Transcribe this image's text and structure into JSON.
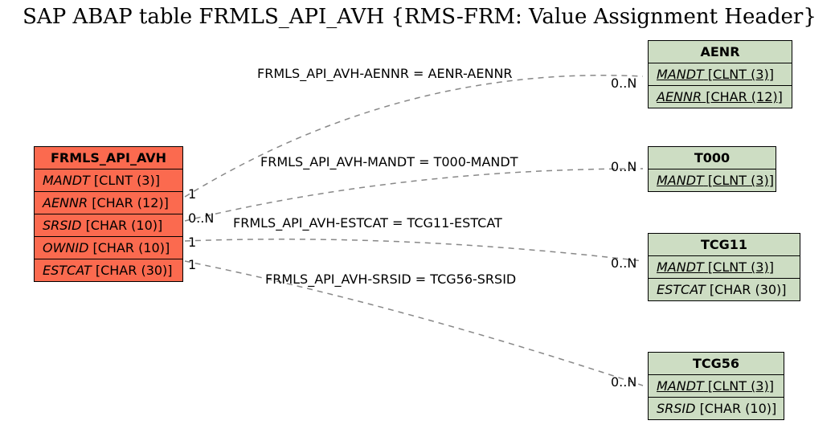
{
  "title": "SAP ABAP table FRMLS_API_AVH {RMS-FRM: Value Assignment Header}",
  "main": {
    "name": "FRMLS_API_AVH",
    "fields": [
      {
        "f": "MANDT",
        "t": "[CLNT (3)]"
      },
      {
        "f": "AENNR",
        "t": "[CHAR (12)]"
      },
      {
        "f": "SRSID",
        "t": "[CHAR (10)]"
      },
      {
        "f": "OWNID",
        "t": "[CHAR (10)]"
      },
      {
        "f": "ESTCAT",
        "t": "[CHAR (30)]"
      }
    ]
  },
  "rel": {
    "r1": {
      "label": "FRMLS_API_AVH-AENNR = AENR-AENNR",
      "left": "1",
      "right": "0..N"
    },
    "r2": {
      "label": "FRMLS_API_AVH-MANDT = T000-MANDT",
      "left": "0..N",
      "right": "0..N"
    },
    "r3": {
      "label": "FRMLS_API_AVH-ESTCAT = TCG11-ESTCAT",
      "left": "1",
      "right": "0..N"
    },
    "r4": {
      "label": "FRMLS_API_AVH-SRSID = TCG56-SRSID",
      "left": "1",
      "right": "0..N"
    }
  },
  "aenr": {
    "name": "AENR",
    "fields": [
      {
        "f": "MANDT",
        "t": "[CLNT (3)]"
      },
      {
        "f": "AENNR",
        "t": "[CHAR (12)]"
      }
    ]
  },
  "t000": {
    "name": "T000",
    "fields": [
      {
        "f": "MANDT",
        "t": "[CLNT (3)]"
      }
    ]
  },
  "tcg11": {
    "name": "TCG11",
    "fields": [
      {
        "f": "MANDT",
        "t": "[CLNT (3)]"
      },
      {
        "f": "ESTCAT",
        "t": "[CHAR (30)]"
      }
    ]
  },
  "tcg56": {
    "name": "TCG56",
    "fields": [
      {
        "f": "MANDT",
        "t": "[CLNT (3)]"
      },
      {
        "f": "SRSID",
        "t": "[CHAR (10)]"
      }
    ]
  }
}
